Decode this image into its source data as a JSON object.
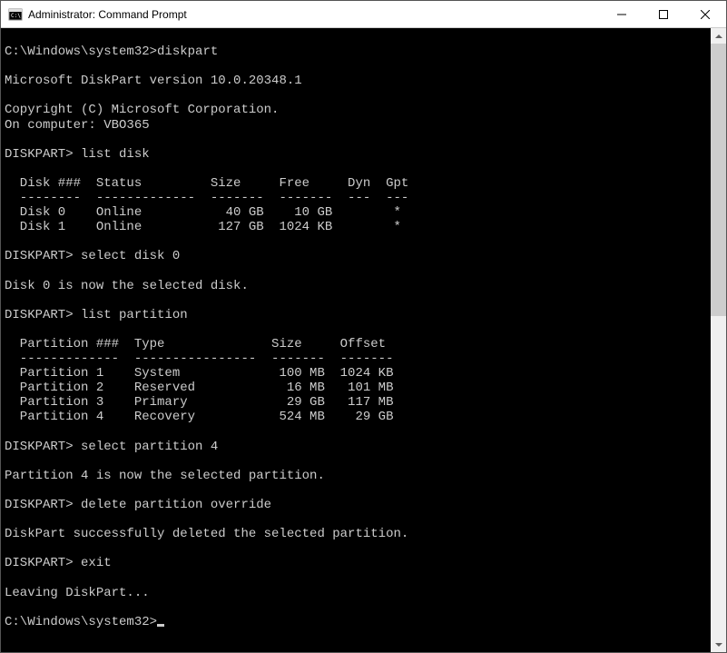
{
  "window": {
    "title": "Administrator: Command Prompt"
  },
  "terminal": {
    "prompt1_path": "C:\\Windows\\system32>",
    "prompt1_cmd": "diskpart",
    "version_line": "Microsoft DiskPart version 10.0.20348.1",
    "copyright_line": "Copyright (C) Microsoft Corporation.",
    "computer_line": "On computer: VBO365",
    "dp_prompt": "DISKPART>",
    "cmd_list_disk": " list disk",
    "disk_header": "  Disk ###  Status         Size     Free     Dyn  Gpt",
    "disk_divider": "  --------  -------------  -------  -------  ---  ---",
    "disk_rows": [
      "  Disk 0    Online           40 GB    10 GB        *",
      "  Disk 1    Online          127 GB  1024 KB        *"
    ],
    "cmd_select_disk": " select disk 0",
    "msg_selected_disk": "Disk 0 is now the selected disk.",
    "cmd_list_partition": " list partition",
    "part_header": "  Partition ###  Type              Size     Offset",
    "part_divider": "  -------------  ----------------  -------  -------",
    "part_rows": [
      "  Partition 1    System             100 MB  1024 KB",
      "  Partition 2    Reserved            16 MB   101 MB",
      "  Partition 3    Primary             29 GB   117 MB",
      "  Partition 4    Recovery           524 MB    29 GB"
    ],
    "cmd_select_partition": " select partition 4",
    "msg_selected_partition": "Partition 4 is now the selected partition.",
    "cmd_delete": " delete partition override",
    "msg_deleted": "DiskPart successfully deleted the selected partition.",
    "cmd_exit": " exit",
    "msg_leaving": "Leaving DiskPart...",
    "prompt2_path": "C:\\Windows\\system32>"
  }
}
